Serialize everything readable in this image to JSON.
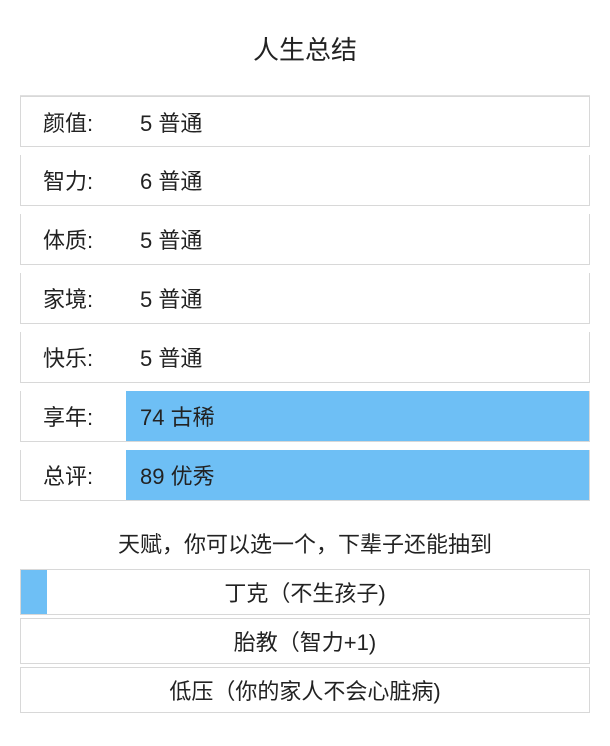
{
  "title": "人生总结",
  "stats": [
    {
      "label": "颜值:",
      "value": "5 普通",
      "highlighted": false
    },
    {
      "label": "智力:",
      "value": "6 普通",
      "highlighted": false
    },
    {
      "label": "体质:",
      "value": "5 普通",
      "highlighted": false
    },
    {
      "label": "家境:",
      "value": "5 普通",
      "highlighted": false
    },
    {
      "label": "快乐:",
      "value": "5 普通",
      "highlighted": false
    },
    {
      "label": "享年:",
      "value": "74 古稀",
      "highlighted": true
    },
    {
      "label": "总评:",
      "value": "89 优秀",
      "highlighted": true
    }
  ],
  "talent_prompt": "天赋，你可以选一个，下辈子还能抽到",
  "talent_options": [
    {
      "label": "丁克（不生孩子)",
      "partial_highlight": true
    },
    {
      "label": "胎教（智力+1)",
      "partial_highlight": false
    },
    {
      "label": "低压（你的家人不会心脏病)",
      "partial_highlight": false
    }
  ],
  "colors": {
    "highlight": "#6ebff5",
    "border": "#d8d8d8"
  }
}
